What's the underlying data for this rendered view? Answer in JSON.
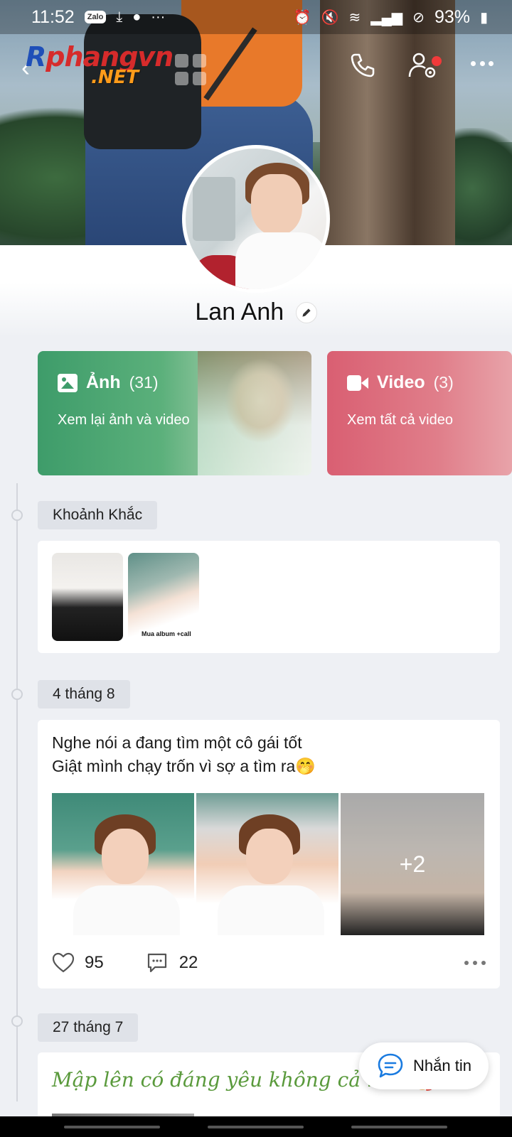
{
  "status_bar": {
    "time": "11:52",
    "app_badge": "Zalo",
    "battery": "93%",
    "icons": [
      "download-icon",
      "chat-bubble-icon",
      "more-dots-icon",
      "alarm-icon",
      "mute-icon",
      "wifi-icon",
      "signal-icon",
      "dnd-icon",
      "battery-icon"
    ]
  },
  "watermark": {
    "line1_a": "R",
    "line1_b": "phangvn",
    "line2": ".NET"
  },
  "header": {
    "icons": [
      "back-icon",
      "call-icon",
      "friend-settings-icon",
      "more-icon"
    ]
  },
  "profile": {
    "name": "Lan Anh"
  },
  "albums": [
    {
      "title": "Ảnh",
      "count": "(31)",
      "subtitle": "Xem lại ảnh và video",
      "icon": "photo-icon",
      "color": "#3e9c6a"
    },
    {
      "title": "Video",
      "count": "(3)",
      "subtitle": "Xem tất cả video",
      "icon": "video-icon",
      "color": "#d95f72"
    }
  ],
  "timeline": {
    "moments_label": "Khoảnh Khắc",
    "moment_caption": "Mua album +call",
    "sections": [
      {
        "date": "4 tháng 8",
        "text_line1": "Nghe nói a đang tìm một cô gái tốt",
        "text_line2": "Giật mình chạy trốn vì sợ a tìm ra🤭",
        "more_photos": "+2",
        "likes": "95",
        "comments": "22"
      },
      {
        "date": "27 tháng 7",
        "text": "Mập lên có đáng yêu không cả nhà 🥰"
      }
    ]
  },
  "fab": {
    "label": "Nhắn tin"
  }
}
